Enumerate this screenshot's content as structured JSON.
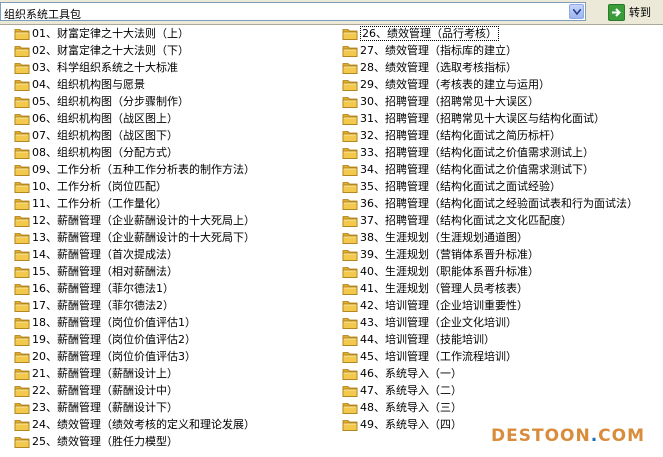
{
  "address": {
    "value": "组织系统工具包"
  },
  "go_button": {
    "label": "转到"
  },
  "colors": {
    "folder": "#f2c94c",
    "go_icon": "#3a9d3a",
    "watermark_text": "#d88c3c",
    "watermark_dot": "#1d6fb8"
  },
  "left_items": [
    "01、财富定律之十大法则（上）",
    "02、财富定律之十大法则（下）",
    "03、科学组织系统之十大标准",
    "04、组织机构图与愿景",
    "05、组织机构图（分步骤制作）",
    "06、组织机构图（战区图上）",
    "07、组织机构图（战区图下）",
    "08、组织机构图（分配方式）",
    "09、工作分析（五种工作分析表的制作方法）",
    "10、工作分析（岗位匹配）",
    "11、工作分析（工作量化）",
    "12、薪酬管理（企业薪酬设计的十大死局上）",
    "13、薪酬管理（企业薪酬设计的十大死局下）",
    "14、薪酬管理（首次提成法）",
    "15、薪酬管理（相对薪酬法）",
    "16、薪酬管理（菲尔德法1）",
    "17、薪酬管理（菲尔德法2）",
    "18、薪酬管理（岗位价值评估1）",
    "19、薪酬管理（岗位价值评估2）",
    "20、薪酬管理（岗位价值评估3）",
    "21、薪酬管理（薪酬设计上）",
    "22、薪酬管理（薪酬设计中）",
    "23、薪酬管理（薪酬设计下）",
    "24、绩效管理（绩效考核的定义和理论发展）",
    "25、绩效管理（胜任力模型）"
  ],
  "right_items": [
    "26、绩效管理（品行考核）",
    "27、绩效管理（指标库的建立）",
    "28、绩效管理（选取考核指标）",
    "29、绩效管理（考核表的建立与运用）",
    "30、招聘管理（招聘常见十大误区）",
    "31、招聘管理（招聘常见十大误区与结构化面试）",
    "32、招聘管理（结构化面试之简历标杆）",
    "33、招聘管理（结构化面试之价值需求测试上）",
    "34、招聘管理（结构化面试之价值需求测试下）",
    "35、招聘管理（结构化面试之面试经验）",
    "36、招聘管理（结构化面试之经验面试表和行为面试法）",
    "37、招聘管理（结构化面试之文化匹配度）",
    "38、生涯规划（生涯规划通道图）",
    "39、生涯规划（营销体系晋升标准）",
    "40、生涯规划（职能体系晋升标准）",
    "41、生涯规划（管理人员考核表）",
    "42、培训管理（企业培训重要性）",
    "43、培训管理（企业文化培训）",
    "44、培训管理（技能培训）",
    "45、培训管理（工作流程培训）",
    "46、系统导入（一）",
    "47、系统导入（二）",
    "48、系统导入（三）",
    "49、系统导入（四）"
  ],
  "selected_item": "26、绩效管理（品行考核）",
  "watermark": {
    "part1": "DESTOON",
    "dot": ".",
    "part2": "COM"
  }
}
